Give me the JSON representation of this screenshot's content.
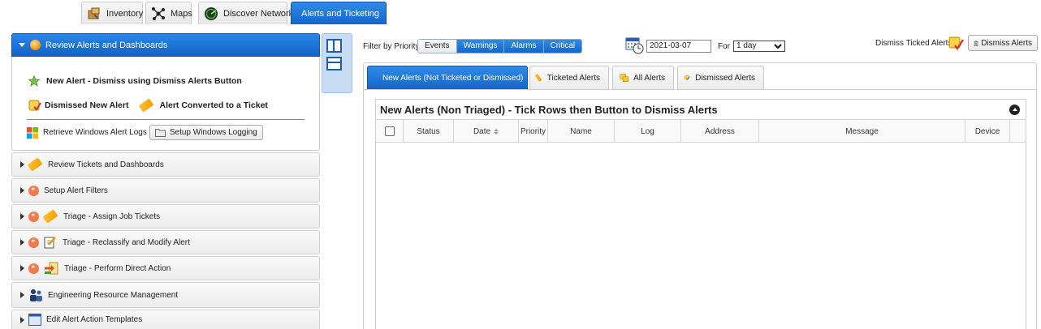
{
  "top_tabs": [
    {
      "label": "Inventory",
      "icon": "inventory-box-icon"
    },
    {
      "label": "Maps",
      "icon": "network-map-icon"
    },
    {
      "label": "Discover Network",
      "icon": "radar-icon"
    },
    {
      "label": "Alerts and Ticketing",
      "icon": "alert-orb-icon",
      "active": true
    }
  ],
  "sidebar": {
    "open_section": {
      "title": "Review Alerts and Dashboards",
      "legend": {
        "new_alert": "New Alert - Dismiss using Dismiss Alerts Button",
        "dismissed": "Dismissed New Alert",
        "converted": "Alert Converted to a Ticket"
      },
      "windows_logs_label": "Retrieve Windows Alert Logs",
      "setup_windows_logging": "Setup Windows Logging"
    },
    "sections": [
      "Review Tickets and Dashboards",
      "Setup Alert Filters",
      "Triage - Assign Job Tickets",
      "Triage - Reclassify and Modify Alert",
      "Triage - Perform Direct Action",
      "Engineering Resource Management",
      "Edit Alert Action Templates"
    ]
  },
  "filter": {
    "label": "Filter by Priority:",
    "options": [
      "Events",
      "Warnings",
      "Alarms",
      "Critical"
    ],
    "selected": [
      "Warnings",
      "Alarms",
      "Critical"
    ]
  },
  "date": {
    "value": "2021-03-07",
    "for_label": "For",
    "period": "1 day"
  },
  "dismiss": {
    "label": "Dismiss Ticked Alerts:",
    "button": "Dismiss Alerts"
  },
  "subtabs": [
    {
      "label": "New Alerts (Not Ticketed or Dismissed)",
      "active": true
    },
    {
      "label": "Ticketed Alerts"
    },
    {
      "label": "All Alerts"
    },
    {
      "label": "Dismissed Alerts"
    }
  ],
  "grid": {
    "title": "New Alerts (Non Triaged) - Tick Rows then Button to Dismiss Alerts",
    "columns": [
      "Status",
      "Date",
      "Priority",
      "Name",
      "Log",
      "Address",
      "Message",
      "Device"
    ]
  },
  "colors": {
    "accent": "#1466cc",
    "accent_light": "#2f8be6"
  }
}
